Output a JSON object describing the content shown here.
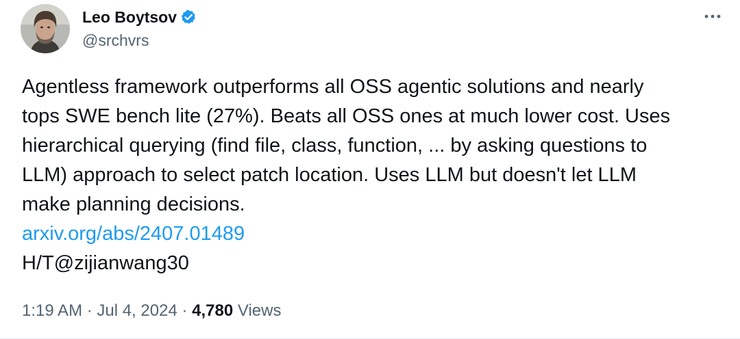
{
  "author": {
    "display_name": "Leo Boytsov",
    "handle": "@srchvrs",
    "verified": true
  },
  "icons": {
    "verified": "verified-badge-icon",
    "more": "more-options-icon",
    "avatar": "user-avatar"
  },
  "tweet": {
    "text": "Agentless framework outperforms all OSS agentic solutions and nearly\ntops SWE bench lite (27%). Beats all OSS ones at much lower cost. Uses\nhierarchical querying (find file, class, function, ... by asking questions to\nLLM) approach to select patch location. Uses LLM but doesn't let LLM\nmake planning decisions.",
    "link": "arxiv.org/abs/2407.01489",
    "ht_prefix": "H/T",
    "ht_mention": "@zijianwang30"
  },
  "meta": {
    "time": "1:19 AM",
    "separator": " · ",
    "date": "Jul 4, 2024",
    "views_count": "4,780",
    "views_label": " Views"
  },
  "colors": {
    "text": "#0f1419",
    "secondary": "#536471",
    "link": "#1d9bf0",
    "verified": "#1d9bf0"
  }
}
